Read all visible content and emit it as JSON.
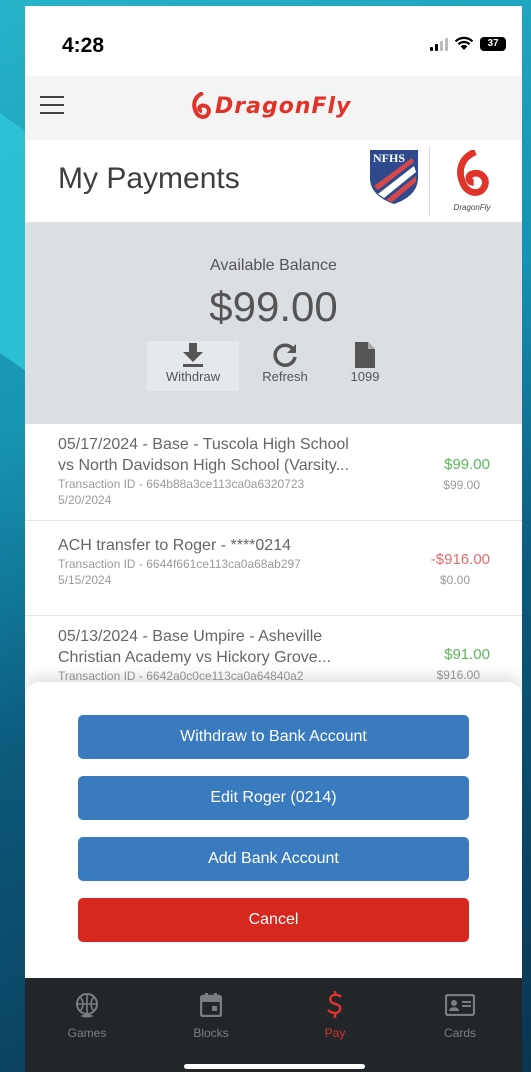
{
  "status": {
    "time": "4:28",
    "battery": "37"
  },
  "header": {
    "logo_text": "DragonFly",
    "menu_icon": "hamburger-menu-icon"
  },
  "title": {
    "text": "My Payments",
    "nfhs_label": "NFHS",
    "badge_text": "DragonFly"
  },
  "balance": {
    "label": "Available Balance",
    "amount": "$99.00",
    "actions": [
      {
        "label": "Withdraw",
        "icon": "download-icon"
      },
      {
        "label": "Refresh",
        "icon": "refresh-icon"
      },
      {
        "label": "1099",
        "icon": "document-icon"
      }
    ]
  },
  "transactions": [
    {
      "line1": "05/17/2024 - Base - Tuscola High School",
      "line2": "vs North Davidson High School (Varsity...",
      "txid": "Transaction ID - 664b88a3ce113ca0a6320723",
      "date": "5/20/2024",
      "amount": "$99.00",
      "balance": "$99.00"
    },
    {
      "line1": "ACH transfer to Roger - ****0214",
      "txid": "Transaction ID - 6644f661ce113ca0a68ab297",
      "date": "5/15/2024",
      "amount": "-$916.00",
      "balance": "$0.00"
    },
    {
      "line1": "05/13/2024 - Base Umpire - Asheville",
      "line2": "Christian Academy vs Hickory Grove...",
      "txid": "Transaction ID - 6642a0c0ce113ca0a64840a2",
      "amount": "$91.00",
      "balance": "$916.00"
    }
  ],
  "sheet": {
    "withdraw": "Withdraw to Bank Account",
    "edit": "Edit Roger (0214)",
    "add": "Add Bank Account",
    "cancel": "Cancel"
  },
  "tabs": [
    {
      "label": "Games",
      "icon": "basketball-icon"
    },
    {
      "label": "Blocks",
      "icon": "calendar-icon"
    },
    {
      "label": "Pay",
      "icon": "dollar-icon"
    },
    {
      "label": "Cards",
      "icon": "id-card-icon"
    }
  ],
  "colors": {
    "accent": "#d8342a",
    "primary_button": "#3a7bbf",
    "cancel_button": "#d6281e",
    "credit": "#5cb85c",
    "debit": "#e66b6b"
  }
}
